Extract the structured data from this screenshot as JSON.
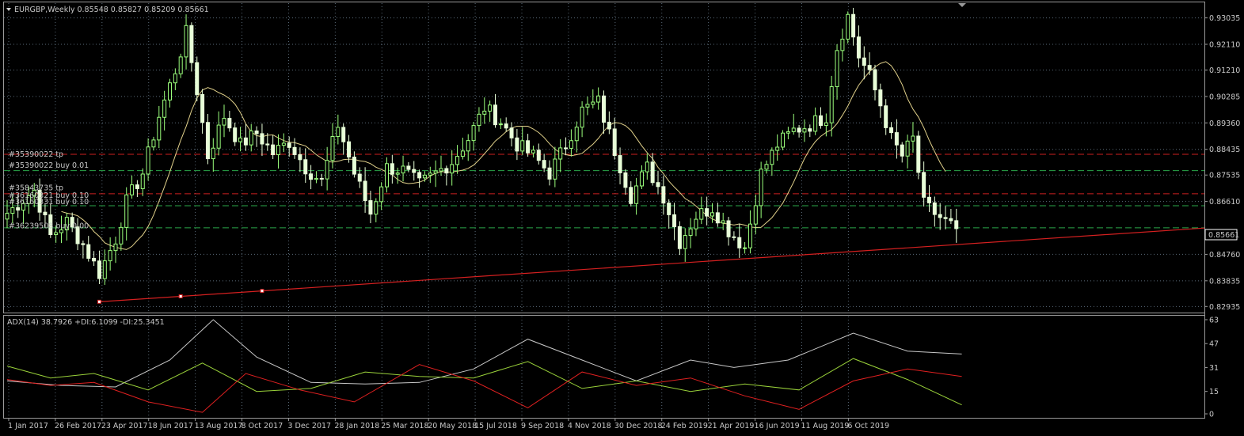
{
  "colors": {
    "background": "#000000",
    "bull": "#9bff7c",
    "bear": "#e8ffd8",
    "grid": "#5a6a78",
    "ma": "#e0d08a",
    "trend": "#d42020",
    "order_tp": "#cc2020",
    "order_entry": "#2aa64a",
    "adx": "#c8c8c8",
    "di_plus": "#9ad23a",
    "di_minus": "#e02020"
  },
  "chart_data": [
    {
      "type": "candlestick",
      "header": "EURGBP,Weekly  0.85548 0.85827 0.85209 0.85661",
      "symbol": "EURGBP",
      "timeframe": "Weekly",
      "ohlc_last": {
        "open": 0.85548,
        "high": 0.85827,
        "low": 0.85209,
        "close": 0.85661
      },
      "ylim": [
        0.8275,
        0.9355
      ],
      "y_ticks": [
        "0.93035",
        "0.92110",
        "0.91210",
        "0.90285",
        "0.89360",
        "0.88435",
        "0.87535",
        "0.86610",
        "0.84760",
        "0.83835",
        "0.82935"
      ],
      "current_price_label": "0.85661",
      "x_tick_labels": [
        "1 Jan 2017",
        "26 Feb 2017",
        "23 Apr 2017",
        "18 Jun 2017",
        "13 Aug 2017",
        "8 Oct 2017",
        "3 Dec 2017",
        "28 Jan 2018",
        "25 Mar 2018",
        "20 May 2018",
        "15 Jul 2018",
        "9 Sep 2018",
        "4 Nov 2018",
        "30 Dec 2018",
        "24 Feb 2019",
        "21 Apr 2019",
        "16 Jun 2019",
        "11 Aug 2019",
        "6 Oct 2019"
      ],
      "close_path": [
        [
          0,
          0.862
        ],
        [
          5,
          0.87
        ],
        [
          8,
          0.854
        ],
        [
          11,
          0.859
        ],
        [
          14,
          0.851
        ],
        [
          17,
          0.841
        ],
        [
          20,
          0.853
        ],
        [
          22,
          0.866
        ],
        [
          25,
          0.876
        ],
        [
          28,
          0.896
        ],
        [
          31,
          0.912
        ],
        [
          33,
          0.925
        ],
        [
          35,
          0.905
        ],
        [
          37,
          0.882
        ],
        [
          40,
          0.896
        ],
        [
          43,
          0.886
        ],
        [
          46,
          0.89
        ],
        [
          49,
          0.883
        ],
        [
          52,
          0.887
        ],
        [
          55,
          0.878
        ],
        [
          58,
          0.873
        ],
        [
          61,
          0.893
        ],
        [
          64,
          0.876
        ],
        [
          67,
          0.862
        ],
        [
          70,
          0.878
        ],
        [
          73,
          0.877
        ],
        [
          76,
          0.872
        ],
        [
          79,
          0.876
        ],
        [
          82,
          0.88
        ],
        [
          85,
          0.888
        ],
        [
          88,
          0.899
        ],
        [
          91,
          0.894
        ],
        [
          94,
          0.886
        ],
        [
          97,
          0.882
        ],
        [
          100,
          0.876
        ],
        [
          103,
          0.886
        ],
        [
          106,
          0.898
        ],
        [
          109,
          0.901
        ],
        [
          112,
          0.884
        ],
        [
          115,
          0.868
        ],
        [
          118,
          0.878
        ],
        [
          121,
          0.868
        ],
        [
          124,
          0.852
        ],
        [
          127,
          0.861
        ],
        [
          130,
          0.864
        ],
        [
          133,
          0.856
        ],
        [
          136,
          0.85
        ],
        [
          139,
          0.876
        ],
        [
          142,
          0.886
        ],
        [
          145,
          0.891
        ],
        [
          148,
          0.893
        ],
        [
          151,
          0.896
        ],
        [
          153,
          0.92
        ],
        [
          155,
          0.931
        ],
        [
          157,
          0.917
        ],
        [
          159,
          0.91
        ],
        [
          161,
          0.9
        ],
        [
          163,
          0.888
        ],
        [
          165,
          0.882
        ],
        [
          167,
          0.888
        ],
        [
          169,
          0.865
        ],
        [
          171,
          0.862
        ],
        [
          173,
          0.859
        ],
        [
          175,
          0.8566
        ]
      ]
    },
    {
      "type": "line",
      "header": "ADX(14) 38.7926 +DI:6.1099 -DI:25.3451",
      "indicator": "ADX",
      "period": 14,
      "adx_last": 38.7926,
      "plus_di_last": 6.1099,
      "minus_di_last": 25.3451,
      "ylim": [
        0,
        63
      ],
      "y_ticks": [
        "63",
        "47",
        "31",
        "15",
        "0"
      ],
      "series": [
        {
          "name": "ADX",
          "points": [
            [
              0,
              22
            ],
            [
              10,
              19
            ],
            [
              20,
              18
            ],
            [
              30,
              36
            ],
            [
              38,
              63
            ],
            [
              46,
              38
            ],
            [
              56,
              21
            ],
            [
              66,
              20
            ],
            [
              76,
              21
            ],
            [
              86,
              30
            ],
            [
              96,
              50
            ],
            [
              106,
              36
            ],
            [
              116,
              22
            ],
            [
              126,
              36
            ],
            [
              134,
              31
            ],
            [
              144,
              36
            ],
            [
              156,
              54
            ],
            [
              166,
              42
            ],
            [
              176,
              40
            ]
          ]
        },
        {
          "name": "+DI",
          "points": [
            [
              0,
              32
            ],
            [
              8,
              24
            ],
            [
              16,
              27
            ],
            [
              26,
              16
            ],
            [
              36,
              34
            ],
            [
              46,
              15
            ],
            [
              56,
              17
            ],
            [
              66,
              28
            ],
            [
              76,
              25
            ],
            [
              86,
              24
            ],
            [
              96,
              35
            ],
            [
              106,
              17
            ],
            [
              116,
              22
            ],
            [
              126,
              15
            ],
            [
              136,
              20
            ],
            [
              146,
              16
            ],
            [
              156,
              37
            ],
            [
              166,
              23
            ],
            [
              176,
              6
            ]
          ]
        },
        {
          "name": "-DI",
          "points": [
            [
              0,
              23
            ],
            [
              8,
              19
            ],
            [
              16,
              21
            ],
            [
              26,
              8
            ],
            [
              36,
              1
            ],
            [
              44,
              27
            ],
            [
              54,
              16
            ],
            [
              64,
              8
            ],
            [
              76,
              33
            ],
            [
              86,
              22
            ],
            [
              96,
              4
            ],
            [
              106,
              28
            ],
            [
              116,
              19
            ],
            [
              126,
              24
            ],
            [
              136,
              12
            ],
            [
              146,
              3
            ],
            [
              156,
              22
            ],
            [
              166,
              30
            ],
            [
              176,
              25
            ]
          ]
        }
      ]
    }
  ],
  "levels": {
    "tp_lines": [
      0.8826,
      0.8688
    ],
    "entry_lines": [
      0.8769,
      0.8646,
      0.8569
    ],
    "labels": [
      {
        "text": "#35390022 tp",
        "price": 0.8826
      },
      {
        "text": "#35390022 buy 0.01",
        "price": 0.8788
      },
      {
        "text": "#35843735 tp",
        "price": 0.8708
      },
      {
        "text": "#36160321 buy 0.10",
        "price": 0.8682
      },
      {
        "text": "#36160331 buy 0.10",
        "price": 0.866
      },
      {
        "text": "#36239508 buy 0.00",
        "price": 0.8575
      }
    ]
  },
  "trendline": {
    "start": [
      0,
      0.831
    ],
    "end": [
      230,
      0.8568
    ],
    "markers": [
      0,
      15,
      30
    ]
  }
}
